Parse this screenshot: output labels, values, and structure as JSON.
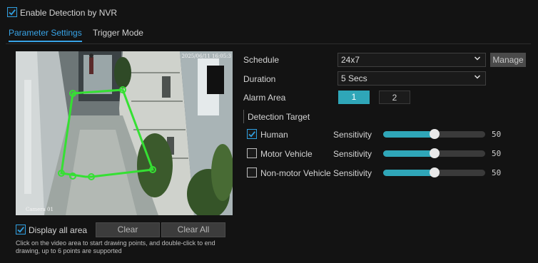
{
  "header": {
    "enable_label": "Enable Detection by NVR",
    "enable_checked": true
  },
  "tabs": [
    {
      "label": "Parameter Settings",
      "active": true
    },
    {
      "label": "Trigger Mode",
      "active": false
    }
  ],
  "video": {
    "timestamp": "2025/06/11 16:05:3",
    "camera_name": "Camera 01"
  },
  "controls": {
    "display_all_label": "Display all area",
    "display_all_checked": true,
    "clear_label": "Clear",
    "clear_all_label": "Clear All",
    "hint": "Click on the video area to start drawing points, and double-click to end drawing, up to 6 points are supported"
  },
  "settings": {
    "schedule_label": "Schedule",
    "schedule_value": "24x7",
    "manage_label": "Manage",
    "duration_label": "Duration",
    "duration_value": "5 Secs",
    "alarm_area_label": "Alarm Area",
    "alarm_areas": [
      "1",
      "2"
    ],
    "alarm_area_active": "1",
    "detection_target_label": "Detection Target",
    "sensitivity_label": "Sensitivity",
    "targets": [
      {
        "name": "Human",
        "checked": true,
        "sensitivity": 50
      },
      {
        "name": "Motor Vehicle",
        "checked": false,
        "sensitivity": 50
      },
      {
        "name": "Non-motor Vehicle",
        "checked": false,
        "sensitivity": 50
      }
    ]
  },
  "colors": {
    "accent": "#38a3e6",
    "teal": "#2fa6b8",
    "roi": "#35e033"
  }
}
